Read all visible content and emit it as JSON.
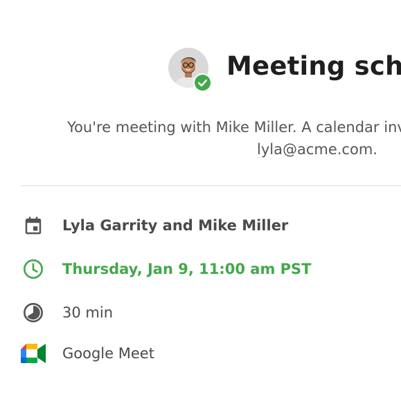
{
  "header": {
    "title": "Meeting scheduled",
    "subtitle_line1": "You're meeting with Mike Miller. A calendar invitation has been sent to",
    "subtitle_line2": "lyla@acme.com."
  },
  "details": {
    "attendees": "Lyla Garrity and Mike Miller",
    "datetime": "Thursday, Jan 9, 11:00 am PST",
    "duration": "30 min",
    "location": "Google Meet"
  },
  "icons": {
    "attendees": "calendar-icon",
    "datetime": "clock-icon",
    "duration": "timer-icon",
    "location": "google-meet-icon",
    "badge": "check-icon"
  },
  "colors": {
    "accent_green": "#43a84b",
    "text_dark": "#1f1f1f",
    "text_muted": "#555555",
    "icon_gray": "#555555"
  }
}
